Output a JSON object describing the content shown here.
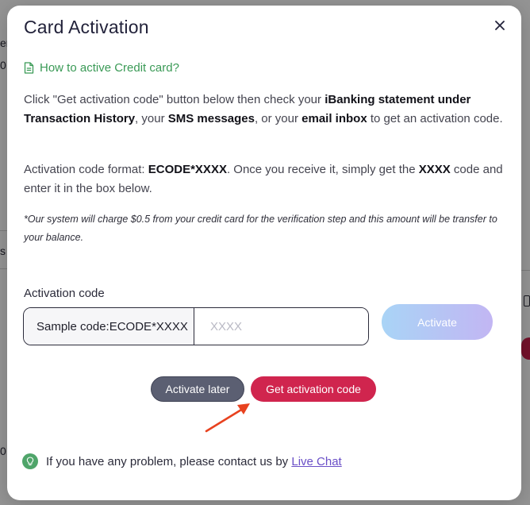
{
  "background": {
    "fragments": [
      "er",
      "0",
      "s",
      "0"
    ]
  },
  "modal": {
    "title": "Card Activation",
    "close_icon": "close-icon",
    "howto_link": "How to active Credit card?",
    "instructions": {
      "p1_a": "Click \"Get activation code\" button below then check your ",
      "p1_b": "iBanking statement under Transaction History",
      "p1_c": ", your ",
      "p1_d": "SMS messages",
      "p1_e": ", or your ",
      "p1_f": "email inbox",
      "p1_g": " to get an activation code.",
      "p2_a": "Activation code format: ",
      "p2_b": "ECODE*XXXX",
      "p2_c": ". Once you receive it, simply get the ",
      "p2_d": "XXXX",
      "p2_e": " code and enter it in the box below."
    },
    "note": "*Our system will charge $0.5 from your credit card for the verification step and this amount will be transfer to your balance.",
    "code_field": {
      "label": "Activation code",
      "prefix": "Sample code:ECODE*XXXX",
      "placeholder": "XXXX",
      "value": ""
    },
    "buttons": {
      "activate": "Activate",
      "activate_later": "Activate later",
      "get_code": "Get activation code"
    },
    "help": {
      "text": "If you have any problem, please contact us by ",
      "link": "Live Chat"
    }
  },
  "colors": {
    "accent_red": "#d0254e",
    "link_green": "#3a9a56",
    "link_purple": "#6a4fc7",
    "annotation_arrow": "#e8421f"
  }
}
